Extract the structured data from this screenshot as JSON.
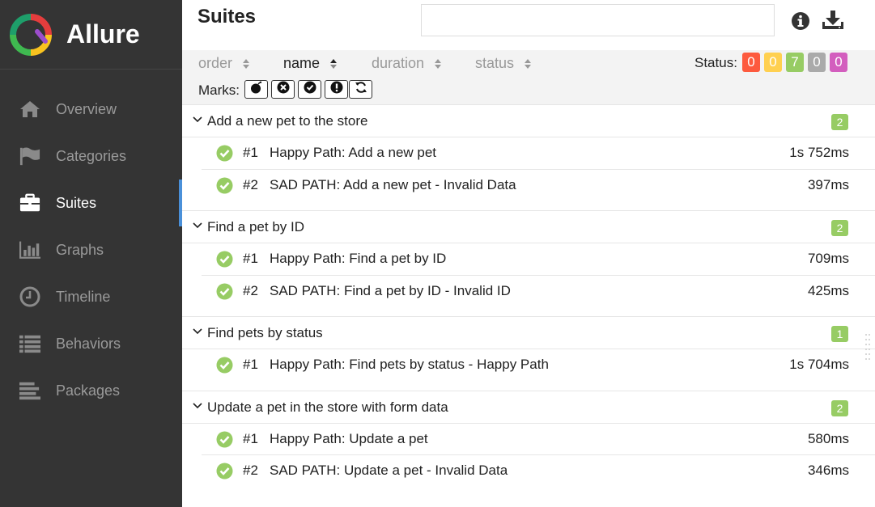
{
  "app": {
    "title": "Allure"
  },
  "sidebar": {
    "items": [
      {
        "label": "Overview",
        "icon": "home-icon"
      },
      {
        "label": "Categories",
        "icon": "flag-icon"
      },
      {
        "label": "Suites",
        "icon": "briefcase-icon",
        "active": true
      },
      {
        "label": "Graphs",
        "icon": "bar-chart-icon"
      },
      {
        "label": "Timeline",
        "icon": "clock-icon"
      },
      {
        "label": "Behaviors",
        "icon": "list-icon"
      },
      {
        "label": "Packages",
        "icon": "align-left-icon"
      }
    ]
  },
  "main": {
    "title": "Suites",
    "search": {
      "value": "",
      "placeholder": ""
    },
    "sort": [
      "order",
      "name",
      "duration",
      "status"
    ],
    "sort_active": "name",
    "status_label": "Status:",
    "status_counts": [
      {
        "value": "0",
        "color": "#fd5a3e"
      },
      {
        "value": "0",
        "color": "#ffd050"
      },
      {
        "value": "7",
        "color": "#97cc64"
      },
      {
        "value": "0",
        "color": "#aaaaaa"
      },
      {
        "value": "0",
        "color": "#d35ebe"
      }
    ],
    "marks_label": "Marks:",
    "marks": [
      "bomb-icon",
      "x-circle-icon",
      "check-circle-icon",
      "exclamation-circle-icon",
      "refresh-icon"
    ]
  },
  "groups": [
    {
      "title": "Add a new pet to the store",
      "count": "2",
      "tests": [
        {
          "num": "#1",
          "name": "Happy Path: Add a new pet",
          "duration": "1s 752ms"
        },
        {
          "num": "#2",
          "name": "SAD PATH: Add a new pet - Invalid Data",
          "duration": "397ms"
        }
      ]
    },
    {
      "title": "Find a pet by ID",
      "count": "2",
      "tests": [
        {
          "num": "#1",
          "name": "Happy Path: Find a pet by ID",
          "duration": "709ms"
        },
        {
          "num": "#2",
          "name": "SAD PATH: Find a pet by ID - Invalid ID",
          "duration": "425ms"
        }
      ]
    },
    {
      "title": "Find pets by status",
      "count": "1",
      "tests": [
        {
          "num": "#1",
          "name": "Happy Path: Find pets by status - Happy Path",
          "duration": "1s 704ms"
        }
      ]
    },
    {
      "title": "Update a pet in the store with form data",
      "count": "2",
      "tests": [
        {
          "num": "#1",
          "name": "Happy Path: Update a pet",
          "duration": "580ms"
        },
        {
          "num": "#2",
          "name": "SAD PATH: Update a pet - Invalid Data",
          "duration": "346ms"
        }
      ]
    }
  ]
}
